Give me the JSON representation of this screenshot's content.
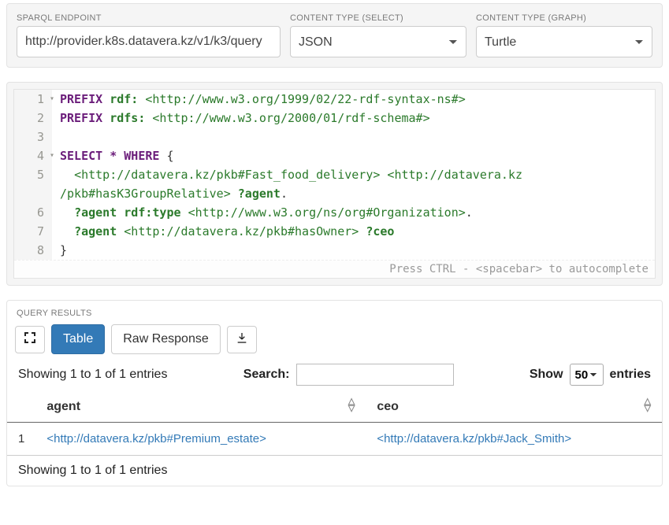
{
  "endpoint": {
    "label": "SPARQL ENDPOINT",
    "value": "http://provider.k8s.datavera.kz/v1/k3/query"
  },
  "content_type_select": {
    "label": "CONTENT TYPE (SELECT)",
    "value": "JSON"
  },
  "content_type_graph": {
    "label": "CONTENT TYPE (GRAPH)",
    "value": "Turtle"
  },
  "query": {
    "lines": {
      "l1_prefix": "PREFIX",
      "l1_name": "rdf:",
      "l1_uri": "<http://www.w3.org/1999/02/22-rdf-syntax-ns#>",
      "l2_prefix": "PREFIX",
      "l2_name": "rdfs:",
      "l2_uri": "<http://www.w3.org/2000/01/rdf-schema#>",
      "l4_select": "SELECT",
      "l4_star": "*",
      "l4_where": "WHERE",
      "l4_brace": "{",
      "l5_part1": "<http://datavera.kz/pkb#Fast_food_delivery>",
      "l5_part2": "<http://datavera.kz",
      "l5_wrap": "/pkb#hasK3GroupRelative>",
      "l5_var": "?agent",
      "l5_dot": ".",
      "l6_var": "?agent",
      "l6_pred": "rdf:type",
      "l6_obj": "<http://www.w3.org/ns/org#Organization>",
      "l6_dot": ".",
      "l7_var": "?agent",
      "l7_pred": "<http://datavera.kz/pkb#hasOwner>",
      "l7_obj": "?ceo",
      "l8_brace": "}"
    },
    "hint": "Press CTRL - <spacebar> to autocomplete"
  },
  "results": {
    "label": "QUERY RESULTS",
    "tab_table": "Table",
    "tab_raw": "Raw Response",
    "info_top": "Showing 1 to 1 of 1 entries",
    "search_label": "Search:",
    "show_label": "Show",
    "entries_label": "entries",
    "page_length": "50",
    "columns": {
      "c1": "agent",
      "c2": "ceo"
    },
    "rows": [
      {
        "idx": "1",
        "agent": "<http://datavera.kz/pkb#Premium_estate>",
        "ceo": "<http://datavera.kz/pkb#Jack_Smith>"
      }
    ],
    "info_bottom": "Showing 1 to 1 of 1 entries"
  }
}
